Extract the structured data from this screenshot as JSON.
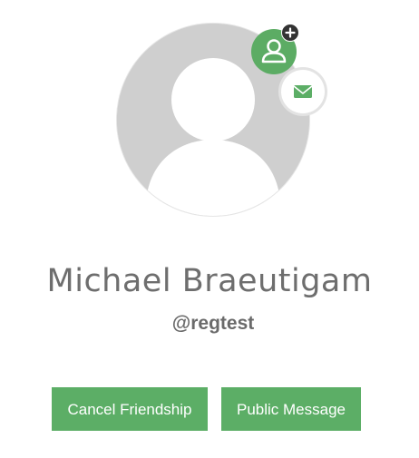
{
  "profile": {
    "name": "Michael Braeutigam",
    "handle": "@regtest"
  },
  "actions": {
    "cancel_friendship_label": "Cancel Friendship",
    "public_message_label": "Public Message"
  },
  "icons": {
    "avatar": "default-user-silhouette",
    "friend": "user-add-icon",
    "badge": "plus-icon",
    "message": "envelope-icon"
  },
  "colors": {
    "accent": "#5cae66",
    "avatar_bg": "#cfcfcf",
    "text": "#6e6e6e",
    "badge": "#333333"
  }
}
